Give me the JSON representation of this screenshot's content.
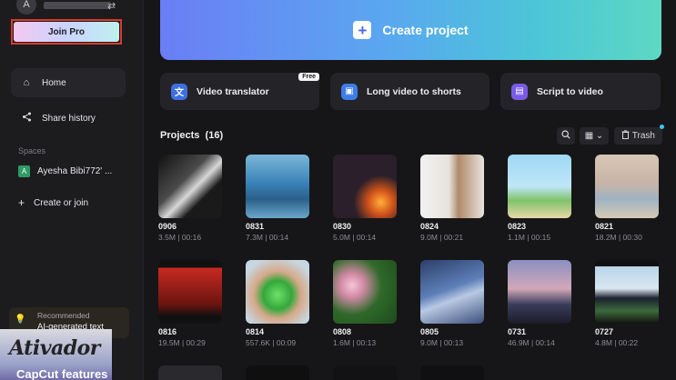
{
  "sidebar": {
    "avatar_letter": "A",
    "join_pro": "Join Pro",
    "home": "Home",
    "share_history": "Share history",
    "spaces_label": "Spaces",
    "space_avatar": "A",
    "space_name": "Ayesha Bibi772' ...",
    "create_or_join": "Create or join",
    "recommended_label": "Recommended",
    "recommended_title": "AI-generated text",
    "promo_logo": "Ativador",
    "promo_text": "CapCut features"
  },
  "banner": {
    "label": "Create project"
  },
  "features": [
    {
      "label": "Video translator",
      "badge": "Free",
      "color": "#3e6fe0"
    },
    {
      "label": "Long video to shorts",
      "color": "#3d7de8"
    },
    {
      "label": "Script to video",
      "color": "#7a5ae8"
    }
  ],
  "projects": {
    "title": "Projects",
    "count": "(16)",
    "trash": "Trash",
    "items": [
      {
        "name": "0906",
        "meta": "3.5M | 00:16",
        "bg": "linear-gradient(135deg,#111 0%,#4a4a4a 40%,#d8d8d8 55%,#1a1a1a 70%)"
      },
      {
        "name": "0831",
        "meta": "7.3M | 00:14",
        "bg": "linear-gradient(180deg,#7ab7d8 0%,#3a82b8 45%,#2a5f8a 70%,#6aa7c8 100%)"
      },
      {
        "name": "0830",
        "meta": "5.0M | 00:14",
        "bg": "radial-gradient(circle at 75% 75%,#ffae3a 0%,#d2541a 18%,#2a1f2a 40%),linear-gradient(180deg,#2a3050,#1a1620)"
      },
      {
        "name": "0824",
        "meta": "9.0M | 00:21",
        "bg": "linear-gradient(90deg,#f2f2f2 0%,#e6e2dc 45%,#b08a6a 60%,#e8e4de 100%)"
      },
      {
        "name": "0823",
        "meta": "1.1M | 00:15",
        "bg": "linear-gradient(180deg,#9fd8f5 0%,#bfe6f7 50%,#7fc36a 72%,#e8d7a8 100%)"
      },
      {
        "name": "0821",
        "meta": "18.2M | 00:30",
        "bg": "linear-gradient(180deg,#d9c7b6 0%,#c8b4a6 45%,#9fb3c4 70%,#d6c9b5 100%)"
      },
      {
        "name": "0816",
        "meta": "19.5M | 00:29",
        "bg": "linear-gradient(180deg,#111 0%,#111 12%,#c82a22 12%,#6a1410 70%,#111 88%)"
      },
      {
        "name": "0814",
        "meta": "557.6K | 00:09",
        "bg": "radial-gradient(circle at 50% 55%,#6ee06a 0%,#34a83a 30%,#d6a88a 50%,#c7d6e0 80%)"
      },
      {
        "name": "0808",
        "meta": "1.6M | 00:13",
        "bg": "radial-gradient(circle at 30% 40%,#f3c6d6 0%,#d28aa6 20%,#2f6a2a 50%,#1f4a1c 100%)"
      },
      {
        "name": "0805",
        "meta": "9.0M | 00:13",
        "bg": "linear-gradient(160deg,#2c3f6a 0%,#5d7fb8 45%,#b9c9e3 60%,#3a4f7a 100%)"
      },
      {
        "name": "0731",
        "meta": "46.9M | 00:14",
        "bg": "linear-gradient(180deg,#8a8fc2 0%,#d3a8b8 45%,#3a3c5a 70%,#1c1c2a 100%)"
      },
      {
        "name": "0727",
        "meta": "4.8M | 00:22",
        "bg": "linear-gradient(180deg,#111 0%,#111 10%,#b8d4ea 10%,#d9e6f0 45%,#1a2030 60%,#3c6a3a 80%,#111 100%)"
      }
    ]
  },
  "icons": {
    "swap": "⇄",
    "home": "⌂",
    "share": "<",
    "plus": "+",
    "search": "⌕",
    "grid": "▦",
    "chevron": "⌄",
    "trash": "🗑",
    "bulb": "💡"
  }
}
